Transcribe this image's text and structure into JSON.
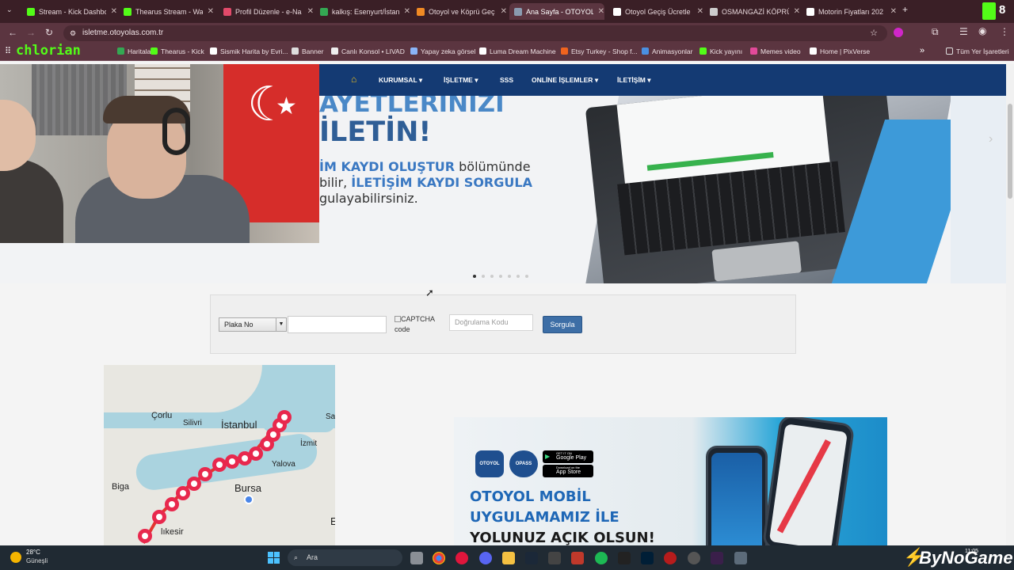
{
  "browser": {
    "tabs": [
      {
        "title": "Stream - Kick Dashbo",
        "color": "#53fc18"
      },
      {
        "title": "Thearus Stream - Wa",
        "color": "#53fc18"
      },
      {
        "title": "Profil Düzenle - e-Na",
        "color": "#e24a6a"
      },
      {
        "title": "kalkış: Esenyurt/İstan",
        "color": "#34a853"
      },
      {
        "title": "Otoyol ve Köprü Geç",
        "color": "#f08a24"
      },
      {
        "title": "Ana Sayfa - OTOYOL",
        "color": "#8a9bb0"
      },
      {
        "title": "Otoyol Geçiş Ücretle",
        "color": "#ffffff"
      },
      {
        "title": "OSMANGAZİ KÖPRÜ",
        "color": "#cccccc"
      },
      {
        "title": "Motorin Fiyatları 202",
        "color": "#ffffff"
      }
    ],
    "active_tab_index": 5,
    "new_tab": "+",
    "url": "isletme.otoyolas.com.tr",
    "overlay_brand": "chlorian",
    "bookmarks": [
      {
        "label": "Haritalar",
        "color": "#34a853"
      },
      {
        "label": "Thearus - Kick",
        "color": "#53fc18"
      },
      {
        "label": "Sismik Harita by Evri...",
        "color": "#ffffff"
      },
      {
        "label": "Banner",
        "color": "#dddddd"
      },
      {
        "label": "Canlı Konsol • LIVAD",
        "color": "#eeeeee"
      },
      {
        "label": "Yapay zeka görsel",
        "color": "#8ab4f8"
      },
      {
        "label": "Luma Dream Machine",
        "color": "#ffffff"
      },
      {
        "label": "Etsy Turkey - Shop f...",
        "color": "#f1641e"
      },
      {
        "label": "Animasyonlar",
        "color": "#4a90e2"
      },
      {
        "label": "Kick yayını",
        "color": "#53fc18"
      },
      {
        "label": "Memes video",
        "color": "#e24a9a"
      },
      {
        "label": "Home | PixVerse",
        "color": "#ffffff"
      }
    ],
    "all_bookmarks": "Tüm Yer İşaretleri",
    "kick_counter": "8"
  },
  "site": {
    "nav": [
      "KURUMSAL",
      "İŞLETME",
      "SSS",
      "ONLİNE İŞLEMLER",
      "İLETİŞİM"
    ],
    "nav_has_dropdown": [
      true,
      true,
      false,
      true,
      true
    ],
    "hero": {
      "line1": "AYETLERİNİZİ",
      "line2": "İLETİN!",
      "line3a": "İM KAYDI OLUŞTUR",
      "line3b": " bölümünde",
      "line4a": "bilir, ",
      "line4b": "İLETİŞİM KAYDI SORGULA",
      "line5": "gulayabilirsiniz."
    },
    "form": {
      "select_value": "Plaka No",
      "captcha_alt": "CAPTCHA code",
      "captcha_line1": "CAPTCHA",
      "captcha_line2": "code",
      "code_placeholder": "Doğrulama Kodu",
      "submit": "Sorgula"
    },
    "map": {
      "labels": [
        "Çorlu",
        "İstanbul",
        "Silivri",
        "İzmit",
        "Yalova",
        "Biga",
        "Bursa",
        "lıkesir",
        "Sa",
        "E"
      ]
    },
    "app": {
      "badges": [
        "OTOYOL",
        "OPASS"
      ],
      "store_google_small": "GET IT ON",
      "store_google": "Google Play",
      "store_apple_small": "Download on the",
      "store_apple": "App Store",
      "line1": "OTOYOL MOBİL",
      "line2": "UYGULAMAMIZ İLE",
      "line3": "YOLUNUZ AÇIK OLSUN!"
    }
  },
  "taskbar": {
    "weather_temp": "28°C",
    "weather_desc": "Güneşli",
    "search": "Ara",
    "time": "11:05",
    "watermark": "ByNoGame"
  }
}
